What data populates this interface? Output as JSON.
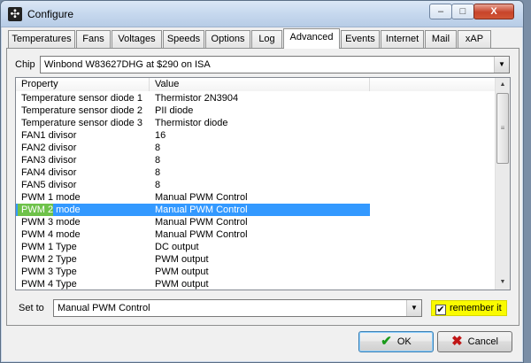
{
  "window": {
    "title": "Configure",
    "app_icon": "speedfan-icon",
    "controls": {
      "minimize": "–",
      "maximize": "□",
      "close": "X"
    }
  },
  "tabs": [
    {
      "label": "Temperatures",
      "active": false
    },
    {
      "label": "Fans",
      "active": false
    },
    {
      "label": "Voltages",
      "active": false
    },
    {
      "label": "Speeds",
      "active": false
    },
    {
      "label": "Options",
      "active": false
    },
    {
      "label": "Log",
      "active": false
    },
    {
      "label": "Advanced",
      "active": true
    },
    {
      "label": "Events",
      "active": false
    },
    {
      "label": "Internet",
      "active": false
    },
    {
      "label": "Mail",
      "active": false
    },
    {
      "label": "xAP",
      "active": false
    }
  ],
  "chip": {
    "label": "Chip",
    "value": "Winbond W83627DHG at $290 on ISA"
  },
  "listview": {
    "columns": [
      "Property",
      "Value"
    ],
    "selected_index": 9,
    "rows": [
      {
        "property": "Temperature sensor diode 1",
        "value": "Thermistor 2N3904"
      },
      {
        "property": "Temperature sensor diode 2",
        "value": "PII diode"
      },
      {
        "property": "Temperature sensor diode 3",
        "value": "Thermistor diode"
      },
      {
        "property": "FAN1 divisor",
        "value": "16"
      },
      {
        "property": "FAN2 divisor",
        "value": "8"
      },
      {
        "property": "FAN3 divisor",
        "value": "8"
      },
      {
        "property": "FAN4 divisor",
        "value": "8"
      },
      {
        "property": "FAN5 divisor",
        "value": "8"
      },
      {
        "property": "PWM 1 mode",
        "value": "Manual PWM Control"
      },
      {
        "property": "PWM 2 mode",
        "value": "Manual PWM Control"
      },
      {
        "property": "PWM 3 mode",
        "value": "Manual PWM Control"
      },
      {
        "property": "PWM 4 mode",
        "value": "Manual PWM Control"
      },
      {
        "property": "PWM 1 Type",
        "value": "DC output"
      },
      {
        "property": "PWM 2 Type",
        "value": "PWM output"
      },
      {
        "property": "PWM 3 Type",
        "value": "PWM output"
      },
      {
        "property": "PWM 4 Type",
        "value": "PWM output"
      }
    ]
  },
  "setto": {
    "label": "Set to",
    "value": "Manual PWM Control"
  },
  "remember": {
    "label": "remember it",
    "checked": true,
    "highlight_color": "#fafb00"
  },
  "buttons": {
    "ok": "OK",
    "cancel": "Cancel"
  },
  "colors": {
    "selection": "#3399ff",
    "row_highlight": "#6ec24a",
    "ok_icon": "#1a9a1a",
    "cancel_icon": "#c01616"
  }
}
